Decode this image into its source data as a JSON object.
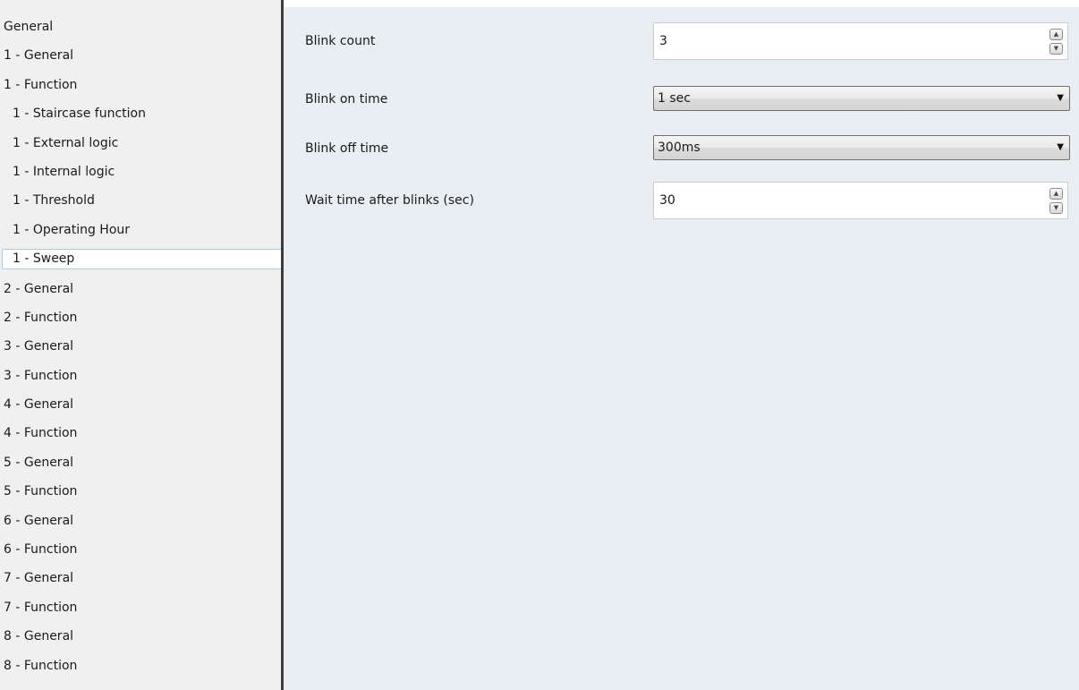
{
  "nav": {
    "items": [
      {
        "label": "General",
        "sub": false,
        "selected": false
      },
      {
        "label": "1 - General",
        "sub": false,
        "selected": false
      },
      {
        "label": "1 - Function",
        "sub": false,
        "selected": false
      },
      {
        "label": "1 - Staircase function",
        "sub": true,
        "selected": false
      },
      {
        "label": "1 - External logic",
        "sub": true,
        "selected": false
      },
      {
        "label": "1 - Internal logic",
        "sub": true,
        "selected": false
      },
      {
        "label": "1 - Threshold",
        "sub": true,
        "selected": false
      },
      {
        "label": "1 - Operating Hour",
        "sub": true,
        "selected": false
      },
      {
        "label": "1 - Sweep",
        "sub": true,
        "selected": true
      },
      {
        "label": "2 - General",
        "sub": false,
        "selected": false
      },
      {
        "label": "2 - Function",
        "sub": false,
        "selected": false
      },
      {
        "label": "3 - General",
        "sub": false,
        "selected": false
      },
      {
        "label": "3 - Function",
        "sub": false,
        "selected": false
      },
      {
        "label": "4 - General",
        "sub": false,
        "selected": false
      },
      {
        "label": "4 - Function",
        "sub": false,
        "selected": false
      },
      {
        "label": "5 - General",
        "sub": false,
        "selected": false
      },
      {
        "label": "5 - Function",
        "sub": false,
        "selected": false
      },
      {
        "label": "6 - General",
        "sub": false,
        "selected": false
      },
      {
        "label": "6 - Function",
        "sub": false,
        "selected": false
      },
      {
        "label": "7 - General",
        "sub": false,
        "selected": false
      },
      {
        "label": "7 - Function",
        "sub": false,
        "selected": false
      },
      {
        "label": "8 - General",
        "sub": false,
        "selected": false
      },
      {
        "label": "8 - Function",
        "sub": false,
        "selected": false
      }
    ]
  },
  "params": {
    "blink_count": {
      "label": "Blink count",
      "value": "3"
    },
    "blink_on_time": {
      "label": "Blink on time",
      "value": "1 sec"
    },
    "blink_off_time": {
      "label": "Blink off time",
      "value": "300ms"
    },
    "wait_time": {
      "label": "Wait time after blinks (sec)",
      "value": "30"
    }
  },
  "icons": {
    "spin_up": "arrow-up-icon",
    "spin_down": "arrow-down-icon",
    "dropdown": "chevron-down-icon"
  },
  "colors": {
    "sidebar_bg": "#f0f0f0",
    "content_bg": "#e9eef3",
    "splitter": "#3c3c3c",
    "selection_border": "#a9cce8"
  }
}
